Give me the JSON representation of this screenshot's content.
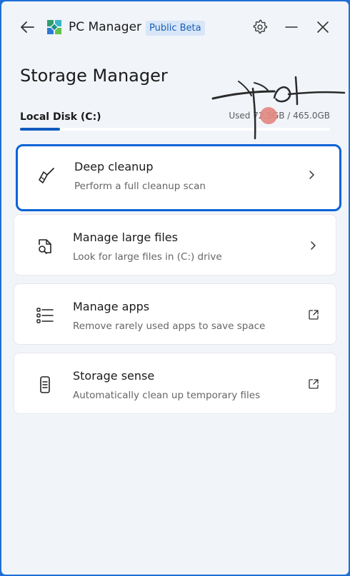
{
  "app": {
    "title": "PC Manager",
    "badge": "Public Beta",
    "icons": {
      "back": "arrow-left-icon",
      "logo": "pc-manager-logo",
      "settings": "gear-icon",
      "minimize": "minimize-icon",
      "close": "close-icon"
    }
  },
  "page": {
    "title": "Storage Manager"
  },
  "disk": {
    "label": "Local Disk (C:)",
    "usage_text": "Used 72.5GB / 465.0GB",
    "used_fraction": 0.13
  },
  "cards": [
    {
      "title": "Deep cleanup",
      "desc": "Perform a full cleanup scan",
      "icon": "broom-icon",
      "trail": "chevron-right-icon",
      "focused": true
    },
    {
      "title": "Manage large files",
      "desc": "Look for large files in (C:) drive",
      "icon": "file-search-icon",
      "trail": "chevron-right-icon",
      "focused": false
    },
    {
      "title": "Manage apps",
      "desc": "Remove rarely used apps to save space",
      "icon": "app-list-icon",
      "trail": "open-external-icon",
      "focused": false
    },
    {
      "title": "Storage sense",
      "desc": "Automatically clean up temporary files",
      "icon": "phone-storage-icon",
      "trail": "open-external-icon",
      "focused": false
    }
  ],
  "colors": {
    "accent": "#0b63d6",
    "window_bg": "#f1f4f9",
    "frame": "#1f6fd6",
    "badge_bg": "#d8e6f8",
    "badge_text": "#1a5fb4"
  }
}
